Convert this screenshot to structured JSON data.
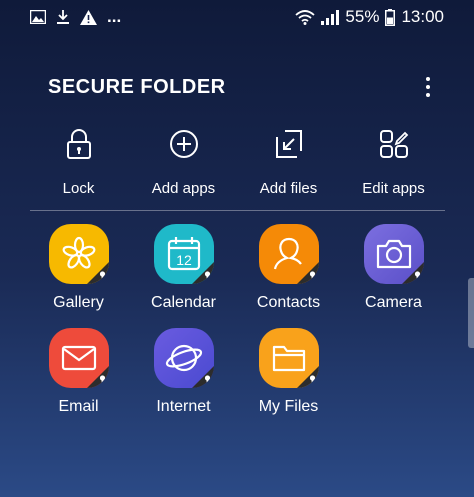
{
  "status_bar": {
    "battery": "55%",
    "time": "13:00",
    "overflow_dots": "...",
    "left_icons": [
      "image-icon",
      "download-icon",
      "warning-icon"
    ],
    "right_icons": [
      "wifi-icon",
      "signal-icon",
      "battery-icon"
    ]
  },
  "header": {
    "title": "SECURE FOLDER",
    "menu_icon": "more-vertical-icon"
  },
  "actions": [
    {
      "label": "Lock",
      "icon": "lock-icon"
    },
    {
      "label": "Add apps",
      "icon": "add-circle-icon"
    },
    {
      "label": "Add files",
      "icon": "add-file-icon"
    },
    {
      "label": "Edit apps",
      "icon": "edit-apps-icon"
    }
  ],
  "apps": [
    {
      "label": "Gallery",
      "icon": "gallery-icon",
      "color": "#f7b900"
    },
    {
      "label": "Calendar",
      "icon": "calendar-icon",
      "color": "#1fb9c9",
      "day": "12"
    },
    {
      "label": "Contacts",
      "icon": "contacts-icon",
      "color": "#f58a07"
    },
    {
      "label": "Camera",
      "icon": "camera-icon",
      "color": "#6e63d6"
    },
    {
      "label": "Email",
      "icon": "email-icon",
      "color": "#ee4b3b"
    },
    {
      "label": "Internet",
      "icon": "internet-icon",
      "color": "#5b5bd6"
    },
    {
      "label": "My Files",
      "icon": "folder-icon",
      "color": "#f9a21b"
    }
  ]
}
